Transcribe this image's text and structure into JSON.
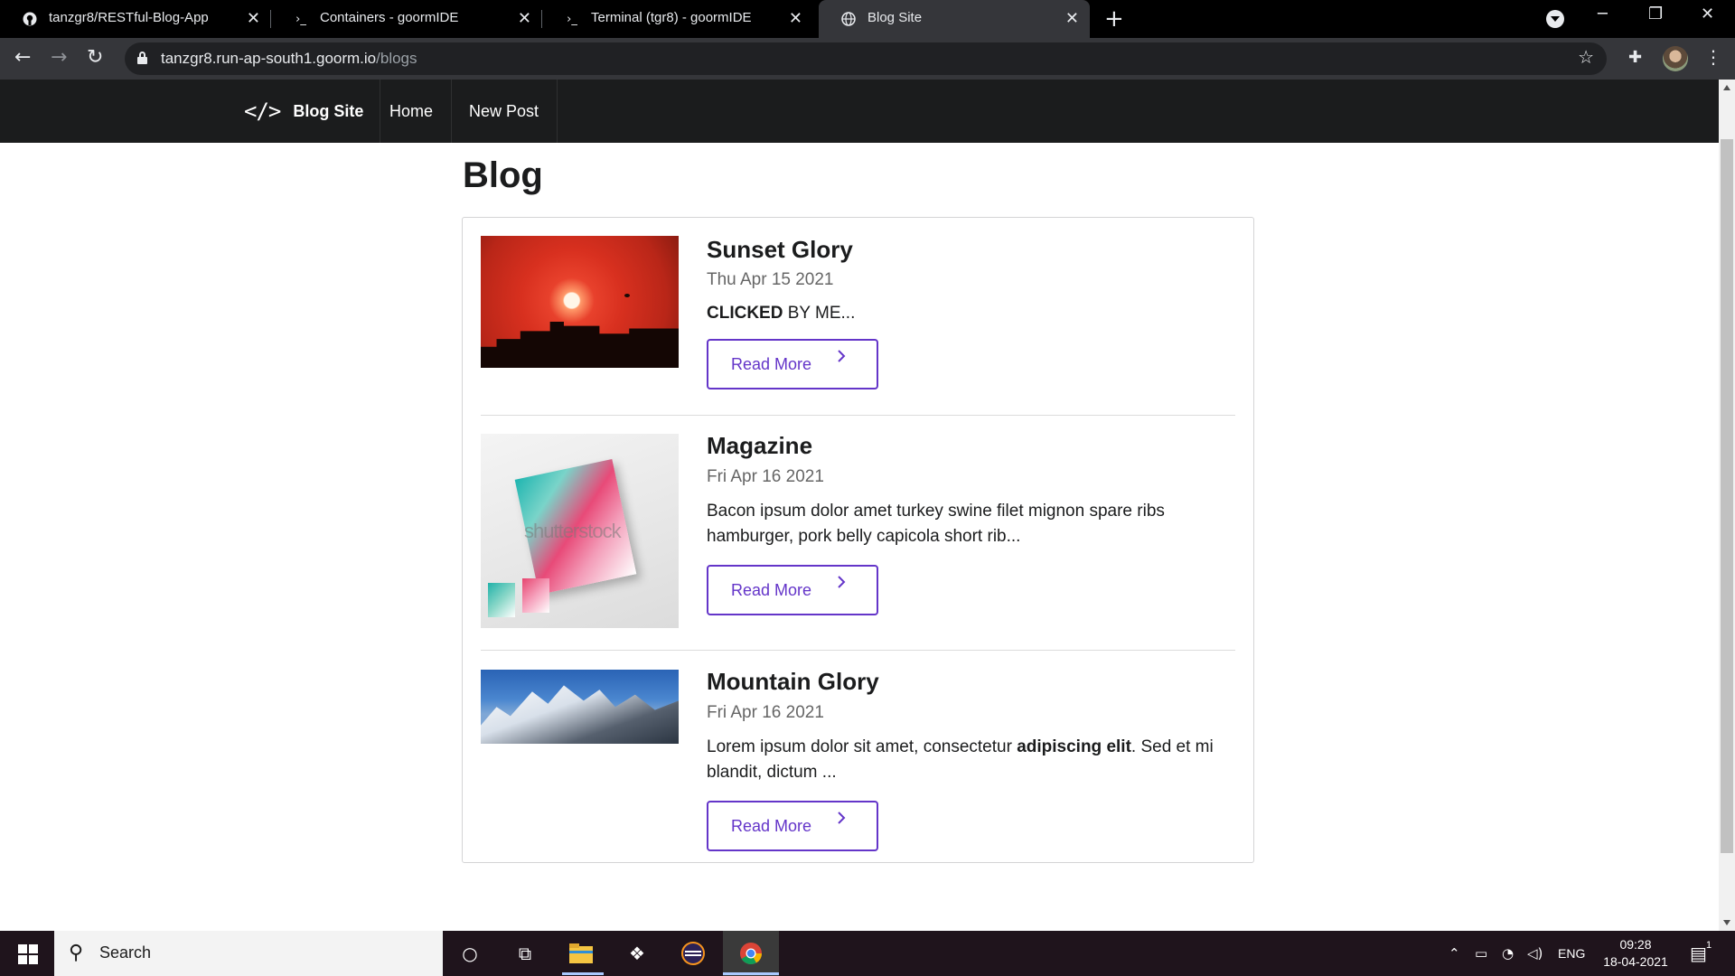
{
  "browser": {
    "tabs": [
      {
        "title": "tanzgr8/RESTful-Blog-App",
        "icon": "github-icon"
      },
      {
        "title": "Containers - goormIDE",
        "icon": "terminal-icon"
      },
      {
        "title": "Terminal (tgr8) - goormIDE",
        "icon": "terminal-icon"
      },
      {
        "title": "Blog Site",
        "icon": "globe-icon",
        "active": true
      }
    ],
    "url_host": "tanzgr8.run-ap-south1.goorm.io",
    "url_path": "/blogs"
  },
  "site": {
    "brand": "Blog Site",
    "nav": [
      "Home",
      "New Post"
    ],
    "heading": "Blog",
    "accent_color": "#6435c9",
    "posts": [
      {
        "title": "Sunset Glory",
        "date": "Thu Apr 15 2021",
        "desc_bold": "CLICKED",
        "desc_rest": " BY ME...",
        "button": "Read More"
      },
      {
        "title": "Magazine",
        "date": "Fri Apr 16 2021",
        "desc": "Bacon ipsum dolor amet turkey swine filet mignon spare ribs hamburger, pork belly capicola short rib...",
        "watermark": "shutterstock",
        "button": "Read More"
      },
      {
        "title": "Mountain Glory",
        "date": "Fri Apr 16 2021",
        "desc_pre": "Lorem ipsum dolor sit amet, consectetur ",
        "desc_bold": "adipiscing elit",
        "desc_post": ". Sed et mi blandit, dictum ...",
        "button": "Read More"
      }
    ]
  },
  "taskbar": {
    "search_placeholder": "Search",
    "language": "ENG",
    "time": "09:28",
    "date": "18-04-2021",
    "notification_count": "1"
  }
}
